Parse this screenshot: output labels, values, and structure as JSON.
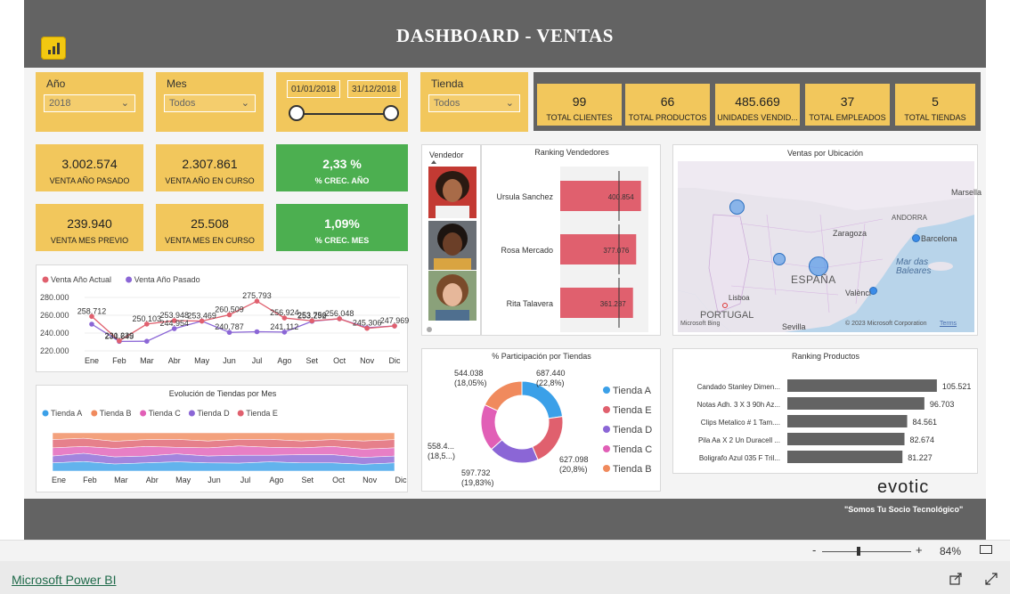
{
  "header": {
    "title": "DASHBOARD - VENTAS",
    "logo_icon": "powerbi-icon"
  },
  "slicers": {
    "year": {
      "label": "Año",
      "value": "2018"
    },
    "month": {
      "label": "Mes",
      "value": "Todos"
    },
    "dates": {
      "from": "01/01/2018",
      "to": "31/12/2018"
    },
    "store": {
      "label": "Tienda",
      "value": "Todos"
    }
  },
  "summary_cards": [
    {
      "value": "99",
      "label": "TOTAL CLIENTES"
    },
    {
      "value": "66",
      "label": "TOTAL PRODUCTOS"
    },
    {
      "value": "485.669",
      "label": "UNIDADES VENDID..."
    },
    {
      "value": "37",
      "label": "TOTAL EMPLEADOS"
    },
    {
      "value": "5",
      "label": "TOTAL TIENDAS"
    }
  ],
  "kpis": {
    "venta_anio_pasado": {
      "value": "3.002.574",
      "label": "VENTA AÑO PASADO"
    },
    "venta_anio_curso": {
      "value": "2.307.861",
      "label": "VENTA AÑO EN CURSO"
    },
    "crec_anio": {
      "value": "2,33 %",
      "label": "% CREC. AÑO"
    },
    "venta_mes_previo": {
      "value": "239.940",
      "label": "VENTA MES PREVIO"
    },
    "venta_mes_curso": {
      "value": "25.508",
      "label": "VENTA MES EN CURSO"
    },
    "crec_mes": {
      "value": "1,09%",
      "label": "% CREC. MES"
    }
  },
  "colors": {
    "yellow": "#f2c75c",
    "green": "#4caf50",
    "header": "#636363",
    "red": "#e0606e",
    "purple": "#8b66d6"
  },
  "chart_data": [
    {
      "type": "line",
      "legend_placement": "top-left",
      "categories": [
        "Ene",
        "Feb",
        "Mar",
        "Abr",
        "May",
        "Jun",
        "Jul",
        "Ago",
        "Set",
        "Oct",
        "Nov",
        "Dic"
      ],
      "series": [
        {
          "name": "Venta Año Actual",
          "color": "#e0606e",
          "values": [
            258712,
            231239,
            250103,
            253948,
            253469,
            260509,
            275793,
            256924,
            253756,
            256048,
            245306,
            247969
          ]
        },
        {
          "name": "Venta Año Pasado",
          "color": "#8b66d6",
          "values": [
            250000,
            230645,
            230800,
            244954,
            253469,
            240787,
            241500,
            241112,
            253292,
            256048,
            246000,
            247969
          ]
        }
      ],
      "data_labels": [
        {
          "text": "258.712",
          "cat": 0,
          "y": 258712
        },
        {
          "text": "231.239",
          "cat": 1,
          "y": 231239
        },
        {
          "text": "230.645",
          "cat": 1,
          "y": 230645
        },
        {
          "text": "250.103",
          "cat": 2,
          "y": 250103
        },
        {
          "text": "253.948",
          "cat": 3,
          "y": 253948
        },
        {
          "text": "244.954",
          "cat": 3,
          "y": 244954
        },
        {
          "text": "253.469",
          "cat": 4,
          "y": 253469
        },
        {
          "text": "260.509",
          "cat": 5,
          "y": 260509
        },
        {
          "text": "240.787",
          "cat": 5,
          "y": 240787
        },
        {
          "text": "275.793",
          "cat": 6,
          "y": 275793
        },
        {
          "text": "256.924",
          "cat": 7,
          "y": 256924
        },
        {
          "text": "241.112",
          "cat": 7,
          "y": 241112
        },
        {
          "text": "253.756",
          "cat": 8,
          "y": 253756
        },
        {
          "text": "253.292",
          "cat": 8,
          "y": 253292
        },
        {
          "text": "256.048",
          "cat": 9,
          "y": 256048
        },
        {
          "text": "245.306",
          "cat": 10,
          "y": 245306
        },
        {
          "text": "247.969",
          "cat": 11,
          "y": 247969
        }
      ],
      "ylim": [
        220000,
        280000
      ],
      "yticks": [
        "280.000",
        "260.000",
        "240.000",
        "220.000"
      ],
      "ytick_values": [
        280000,
        260000,
        240000,
        220000
      ]
    },
    {
      "type": "area",
      "title": "Evolución de Tiendas por Mes",
      "legend_placement": "top-left",
      "categories": [
        "Ene",
        "Feb",
        "Mar",
        "Abr",
        "May",
        "Jun",
        "Jul",
        "Ago",
        "Set",
        "Oct",
        "Nov",
        "Dic"
      ],
      "series": [
        {
          "name": "Tienda A",
          "color": "#3ba0e8"
        },
        {
          "name": "Tienda B",
          "color": "#f08a5d"
        },
        {
          "name": "Tienda C",
          "color": "#e15fb6"
        },
        {
          "name": "Tienda D",
          "color": "#8b66d6"
        },
        {
          "name": "Tienda E",
          "color": "#e0606e"
        }
      ]
    },
    {
      "type": "bar",
      "title": "Ranking Vendedores",
      "categories": [
        "Ursula Sanchez",
        "Rosa Mercado",
        "Rita Talavera"
      ],
      "values": [
        400854,
        377076,
        361287
      ],
      "value_labels": [
        "400.854",
        "377.076",
        "361.287"
      ],
      "xlim": [
        0,
        420000
      ],
      "color": "#e0606e"
    },
    {
      "type": "pie",
      "title": "% Participación por Tiendas",
      "slices": [
        {
          "name": "Tienda A",
          "value": 687440,
          "pct": 22.8,
          "label": "687.440",
          "pct_label": "(22,8%)",
          "color": "#3ba0e8"
        },
        {
          "name": "Tienda E",
          "value": 627098,
          "pct": 20.8,
          "label": "627.098",
          "pct_label": "(20,8%)",
          "color": "#e0606e"
        },
        {
          "name": "Tienda D",
          "value": 597732,
          "pct": 19.83,
          "label": "597.732",
          "pct_label": "(19,83%)",
          "color": "#8b66d6"
        },
        {
          "name": "Tienda C",
          "value": 558400,
          "pct": 18.5,
          "label": "558.4...",
          "pct_label": "(18,5...)",
          "color": "#e15fb6"
        },
        {
          "name": "Tienda B",
          "value": 544038,
          "pct": 18.05,
          "label": "544.038",
          "pct_label": "(18,05%)",
          "color": "#f08a5d"
        }
      ],
      "legend": [
        "Tienda A",
        "Tienda E",
        "Tienda D",
        "Tienda C",
        "Tienda B"
      ],
      "legend_placement": "right"
    },
    {
      "type": "bar",
      "title": "Ranking Productos",
      "categories": [
        "Candado Stanley Dimen...",
        "Notas Adh. 3 X 3 90h Az...",
        "Clips Metalico # 1 Tam....",
        "Pila Aa X 2 Un Duracell ...",
        "Boligrafo Azul 035 F Tril..."
      ],
      "values": [
        105521,
        96703,
        84561,
        82674,
        81227
      ],
      "value_labels": [
        "105.521",
        "96.703",
        "84.561",
        "82.674",
        "81.227"
      ],
      "xlim": [
        0,
        110000
      ],
      "color": "#636363"
    }
  ],
  "vendors": {
    "title": "Vendedor",
    "names": [
      "Ursula Sanchez",
      "Rosa Mercado",
      "Rita Talavera"
    ]
  },
  "map": {
    "title": "Ventas por Ubicación",
    "labels": {
      "espana": "ESPAÑA",
      "portugal": "PORTUGAL",
      "andorra": "ANDORRA",
      "marsella": "Marsella",
      "zaragoza": "Zaragoza",
      "barcelona": "Barcelona",
      "mar": "Mar das\nBaleares",
      "lisboa": "Lisboa",
      "sevilla": "Sevilla",
      "valencia": "Valènci"
    },
    "copyright": "© 2023 Microsoft Corporation",
    "terms": "Terms",
    "bing": "Microsoft Bing"
  },
  "footer": {
    "brand": "evotic",
    "tagline": "\"Somos Tu Socio Tecnológico\""
  },
  "zoom": {
    "minus": "-",
    "plus": "+",
    "level": "84%"
  },
  "powerbi": {
    "link": "Microsoft Power BI"
  }
}
